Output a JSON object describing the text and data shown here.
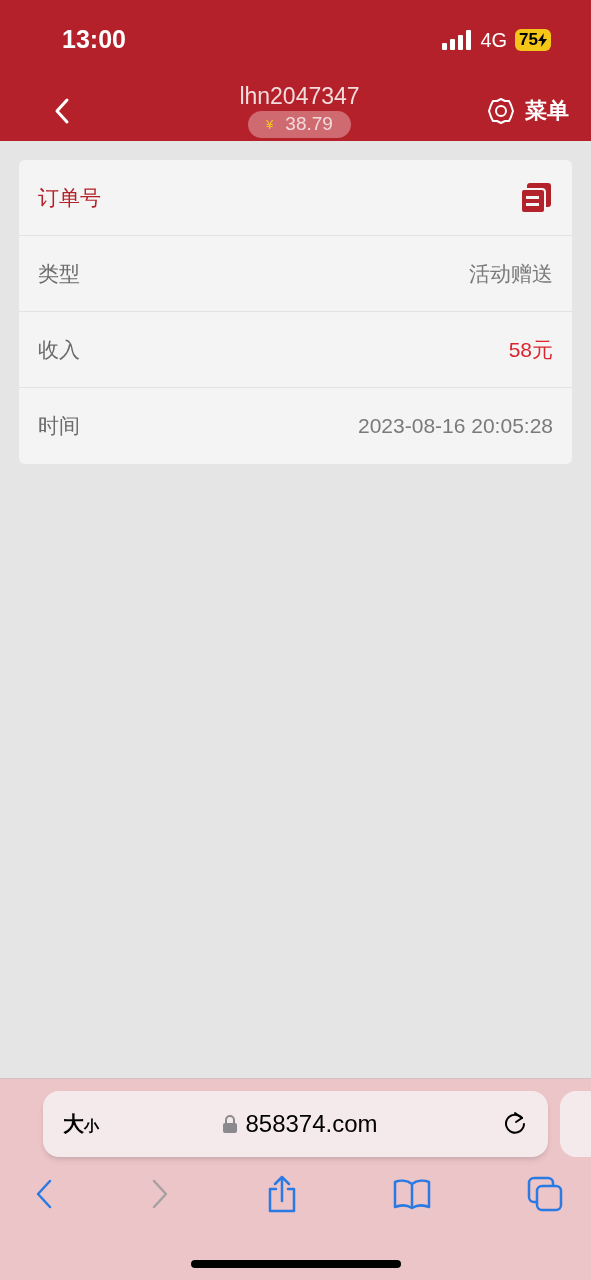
{
  "status_bar": {
    "time": "13:00",
    "network": "4G",
    "battery": "75"
  },
  "header": {
    "title": "lhn2047347",
    "balance_currency": "¥",
    "balance": "38.79",
    "menu_label": "菜单"
  },
  "rows": [
    {
      "kind": "header",
      "label": "订单号"
    },
    {
      "kind": "text",
      "label": "类型",
      "value": "活动赠送"
    },
    {
      "kind": "amount",
      "label": "收入",
      "value": "58元"
    },
    {
      "kind": "text",
      "label": "时间",
      "value": "2023-08-16 20:05:28"
    }
  ],
  "browser": {
    "text_size_large": "大",
    "text_size_small": "小",
    "url": "858374.com",
    "forward_disabled": true
  }
}
